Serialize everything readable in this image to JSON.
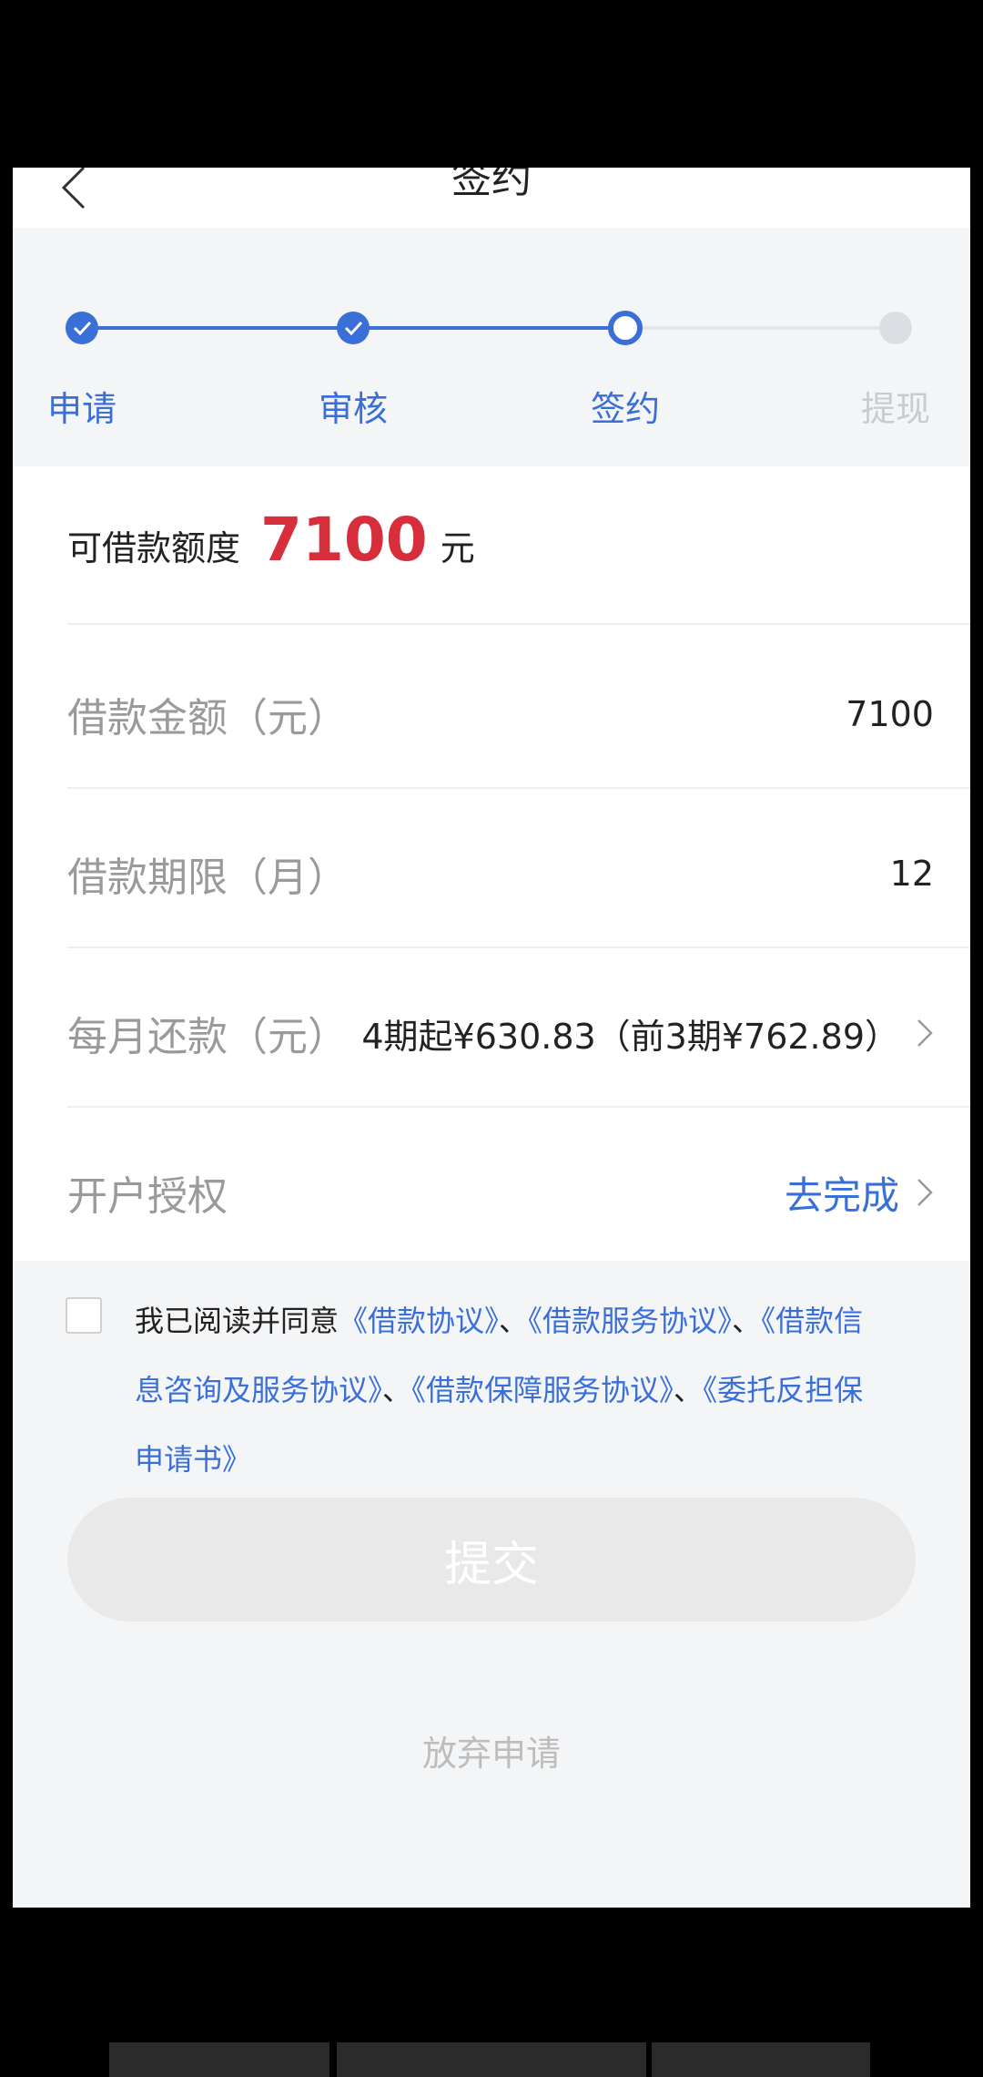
{
  "header": {
    "title": "签约"
  },
  "steps": [
    {
      "label": "申请",
      "state": "done"
    },
    {
      "label": "审核",
      "state": "done"
    },
    {
      "label": "签约",
      "state": "current"
    },
    {
      "label": "提现",
      "state": "pending"
    }
  ],
  "quota": {
    "label": "可借款额度",
    "amount": "7100",
    "unit": "元"
  },
  "form": {
    "loan_amount": {
      "label": "借款金额（元）",
      "value": "7100"
    },
    "loan_term": {
      "label": "借款期限（月）",
      "value": "12"
    },
    "monthly_repay": {
      "label": "每月还款（元）",
      "value": "4期起¥630.83（前3期¥762.89）"
    },
    "account_auth": {
      "label": "开户授权",
      "value": "去完成"
    }
  },
  "agreement": {
    "prefix": "我已阅读并同意",
    "link1": "《借款协议》",
    "sep1": "、",
    "link2": "《借款服务协议》",
    "sep2": "、",
    "link3": "《借款信息咨询及服务协议》",
    "sep3": "、",
    "link4": "《借款保障服务协议》",
    "sep4": "、",
    "link5": "《委托反担保申请书》",
    "checked": false
  },
  "actions": {
    "submit": "提交",
    "abandon": "放弃申请"
  },
  "colors": {
    "accent": "#3a6fd8",
    "amount": "#d72e3b",
    "disabled": "#e9e9ea"
  }
}
